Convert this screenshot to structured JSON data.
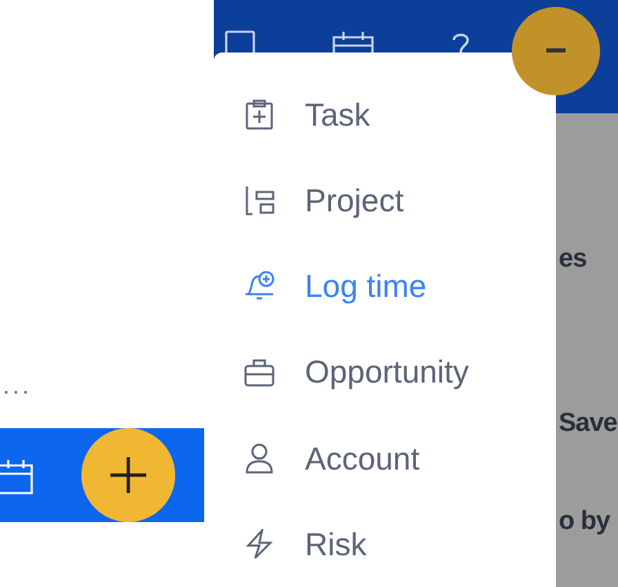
{
  "left_panel": {
    "ellipsis": "..."
  },
  "header_icons": [
    {
      "kind": "square"
    },
    {
      "kind": "calendar"
    },
    {
      "kind": "help"
    }
  ],
  "menu": {
    "items": [
      {
        "label": "Task",
        "kind": "task",
        "selected": false
      },
      {
        "label": "Project",
        "kind": "project",
        "selected": false
      },
      {
        "label": "Log time",
        "kind": "logtime",
        "selected": true
      },
      {
        "label": "Opportunity",
        "kind": "opportunity",
        "selected": false
      },
      {
        "label": "Account",
        "kind": "account",
        "selected": false
      },
      {
        "label": "Risk",
        "kind": "risk",
        "selected": false
      }
    ]
  },
  "background_fragments": [
    "es",
    "Save",
    "o by"
  ]
}
